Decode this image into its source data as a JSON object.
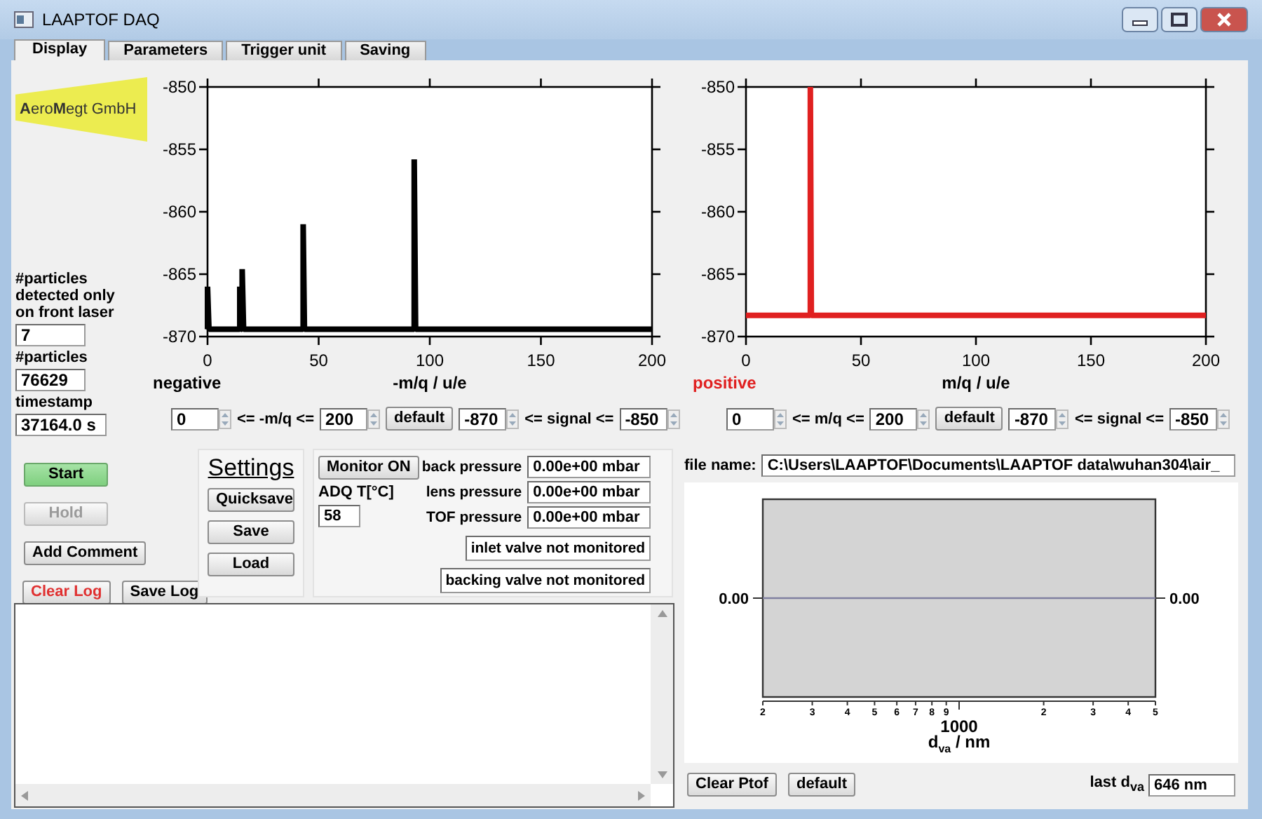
{
  "window": {
    "title": "LAAPTOF DAQ"
  },
  "tabs": [
    {
      "label": "Display",
      "selected": true
    },
    {
      "label": "Parameters",
      "selected": false
    },
    {
      "label": "Trigger unit",
      "selected": false
    },
    {
      "label": "Saving",
      "selected": false
    }
  ],
  "logo": {
    "text": "**A**ero**M**egt GmbH"
  },
  "stats": [
    {
      "label": "#particles detected only on front laser",
      "value": "7"
    },
    {
      "label": "#particles",
      "value": "76629"
    },
    {
      "label": "timestamp",
      "value": "37164.0 s"
    }
  ],
  "charts": [
    {
      "chart_data": {
        "type": "line",
        "xlabel": "-m/q / u/e",
        "xlim": [
          0,
          200
        ],
        "ylim": [
          -870,
          -850
        ],
        "xticks": [
          0,
          50,
          100,
          150,
          200
        ],
        "yticks": [
          -870,
          -865,
          -860,
          -855,
          -850
        ],
        "x": [
          0,
          0,
          0.6,
          14.5,
          14.5,
          15,
          15.6,
          15.6,
          16.2,
          43,
          43,
          43.6,
          93,
          93,
          93.6,
          200
        ],
        "series": [
          {
            "name": "negative",
            "color": "#000000",
            "values": [
              -869.4,
              -866,
              -869.4,
              -869.4,
              -866,
              -869.4,
              -869.4,
              -864.6,
              -869.4,
              -869.4,
              -861,
              -869.4,
              -869.4,
              -855.8,
              -869.4,
              -869.4
            ]
          }
        ]
      },
      "range": {
        "min": "0",
        "mq_label": "<= -m/q <=",
        "max": "200",
        "button": "default",
        "signal_min": "-870",
        "signal_label": "<= signal <=",
        "signal_max": "-850"
      }
    },
    {
      "chart_data": {
        "type": "line",
        "xlabel": "m/q / u/e",
        "xlim": [
          0,
          200
        ],
        "ylim": [
          -870,
          -850
        ],
        "xticks": [
          0,
          50,
          100,
          150,
          200
        ],
        "yticks": [
          -870,
          -865,
          -860,
          -855,
          -850
        ],
        "x": [
          0,
          28,
          28,
          28.4,
          200
        ],
        "series": [
          {
            "name": "positive",
            "color": "#e02020",
            "values": [
              -868.3,
              -868.3,
              -850,
              -868.3,
              -868.3
            ]
          }
        ]
      },
      "range": {
        "min": "0",
        "mq_label": "<= m/q <=",
        "max": "200",
        "button": "default",
        "signal_min": "-870",
        "signal_label": "<= signal <=",
        "signal_max": "-850"
      }
    }
  ],
  "control_buttons": [
    {
      "label": "Start",
      "kind": "go",
      "disabled": false
    },
    {
      "label": "Hold",
      "kind": "normal",
      "disabled": true
    },
    {
      "label": "Add Comment",
      "kind": "normal",
      "disabled": false
    },
    {
      "label": "Clear Log",
      "kind": "warn",
      "disabled": false
    },
    {
      "label": "Save Log",
      "kind": "normal",
      "disabled": false
    }
  ],
  "settings": {
    "title": "Settings",
    "buttons": [
      "Quicksave",
      "Save",
      "Load"
    ]
  },
  "monitor": {
    "button": "Monitor ON",
    "temp_label": "ADQ T[°C]",
    "temp_value": "58",
    "pressures": [
      {
        "label": "back pressure",
        "value": "0.00e+00 mbar"
      },
      {
        "label": "lens pressure",
        "value": "0.00e+00 mbar"
      },
      {
        "label": "TOF pressure",
        "value": "0.00e+00 mbar"
      }
    ],
    "valves": [
      "inlet valve not monitored",
      "backing valve not monitored"
    ]
  },
  "file": {
    "label": "file name:",
    "value": "C:\\Users\\LAAPTOF\\Documents\\LAAPTOF data\\wuhan304\\air_"
  },
  "size_chart": {
    "xlabel": "d$_{va}$ / nm",
    "x_tick_labels": [
      "2",
      "3",
      "4",
      "5",
      "6",
      "7",
      "8",
      "9",
      "1000",
      "2",
      "3",
      "4",
      "5"
    ],
    "left_label": "0.00",
    "right_label": "0.00"
  },
  "size_buttons": [
    "Clear Ptof",
    "default"
  ],
  "last_dva": {
    "label": "last d$_{va}$",
    "value": "646 nm"
  }
}
